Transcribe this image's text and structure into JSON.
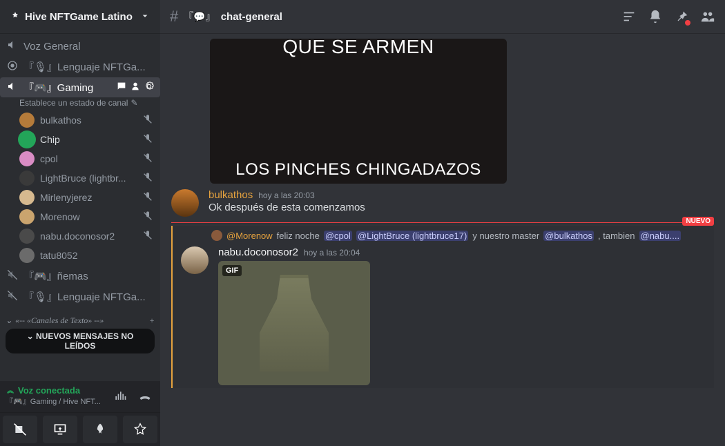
{
  "server": {
    "name": "Hive NFTGame Latino"
  },
  "header": {
    "channel_prefix": "『💬』",
    "channel_name": "chat-general"
  },
  "sidebar": {
    "top_channels": [
      {
        "icon": "speaker",
        "label": "Voz General",
        "truncated": false
      },
      {
        "icon": "stage",
        "label": "『🎙』Lenguaje NFTGa..."
      }
    ],
    "active_voice": {
      "label": "『🎮』Gaming",
      "set_status": "Establece un estado de canal"
    },
    "voice_users": [
      {
        "name": "bulkathos",
        "muted": true,
        "color": "#b57b3a"
      },
      {
        "name": "Chip",
        "muted": true,
        "bold": true,
        "ring": true,
        "color": "#23a559"
      },
      {
        "name": "cpol",
        "muted": true,
        "color": "#d98cc4"
      },
      {
        "name": "LightBruce (lightbr...",
        "muted": true,
        "color": "#3a3a3a"
      },
      {
        "name": "Mirlenyjerez",
        "muted": true,
        "color": "#d6b98f"
      },
      {
        "name": "Morenow",
        "muted": true,
        "color": "#caa46e"
      },
      {
        "name": "nabu.doconosor2",
        "muted": true,
        "color": "#4a4a4a"
      },
      {
        "name": "tatu8052",
        "muted": false,
        "color": "#6b6b6b"
      }
    ],
    "lower_channels": [
      {
        "label": "『🎮』ñemas"
      },
      {
        "label": "『🎙』Lenguaje NFTGa..."
      }
    ],
    "category_label": "«-- «Canales de Texto» --»",
    "unread_label": "NUEVOS MENSAJES NO LEÍDOS"
  },
  "voice_panel": {
    "status": "Voz conectada",
    "channel": "『🎮』Gaming / Hive NFT..."
  },
  "messages": {
    "meme_top": "QUE SE ARMEN",
    "meme_bottom": "LOS PINCHES CHINGADAZOS",
    "msg1": {
      "author": "bulkathos",
      "time": "hoy a las 20:03",
      "text": "Ok después de esta comenzamos"
    },
    "new_tag": "NUEVO",
    "reply": {
      "author": "@Morenow",
      "text_before": "feliz noche",
      "mention1": "@cpol",
      "mention2": "@LightBruce (lightbruce17)",
      "text_mid": "y nuestro master",
      "mention3": "@bulkathos",
      "text_after": ", tambien",
      "mention4": "@nabu...."
    },
    "msg2": {
      "author": "nabu.doconosor2",
      "time": "hoy a las 20:04",
      "gif_tag": "GIF"
    }
  }
}
